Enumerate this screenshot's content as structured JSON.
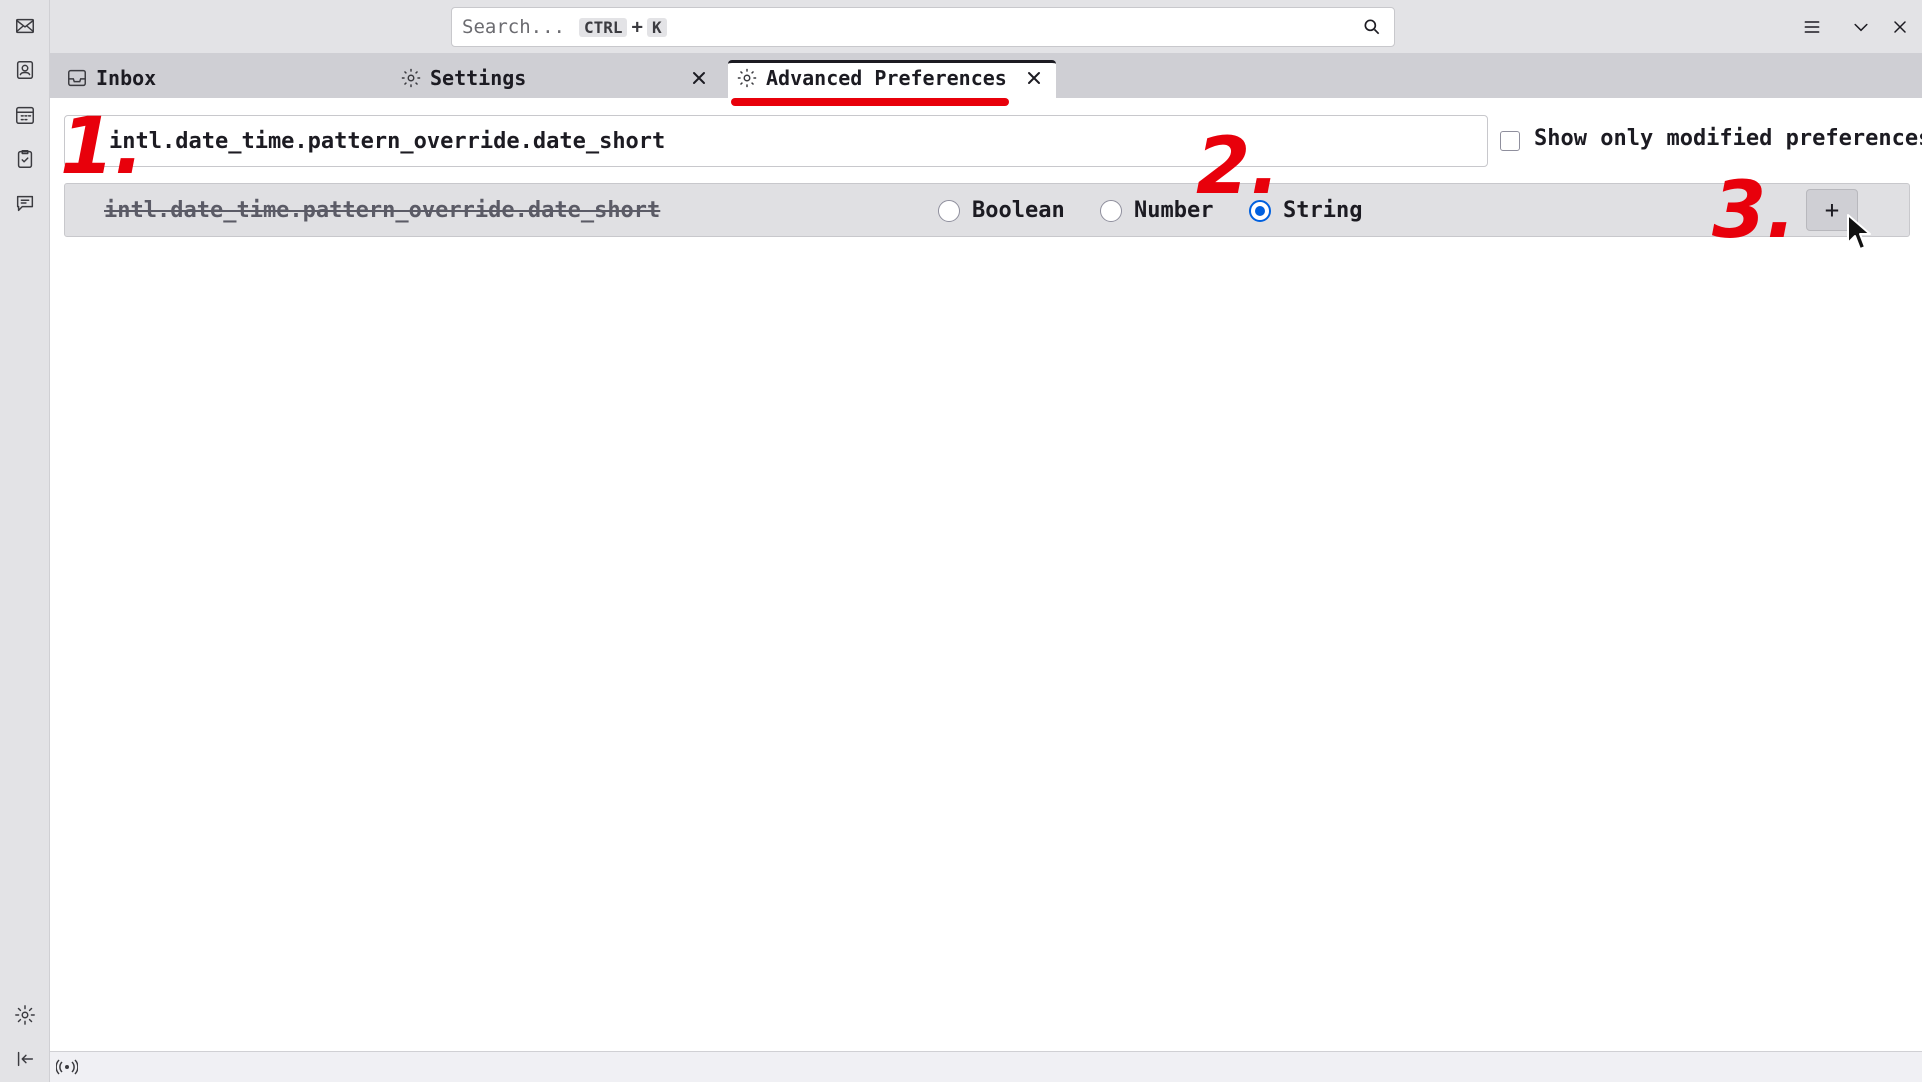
{
  "app": {
    "search": {
      "placeholder": "Search...",
      "shortcut_mod": "CTRL",
      "shortcut_plus": "+",
      "shortcut_key": "K"
    }
  },
  "spaces": [
    {
      "name": "mail",
      "icon": "envelope-icon"
    },
    {
      "name": "address-book",
      "icon": "address-book-icon"
    },
    {
      "name": "calendar",
      "icon": "calendar-icon"
    },
    {
      "name": "tasks",
      "icon": "tasks-icon"
    },
    {
      "name": "chat",
      "icon": "chat-icon"
    }
  ],
  "spaces_bottom": [
    {
      "name": "settings",
      "icon": "gear-icon"
    },
    {
      "name": "collapse",
      "icon": "collapse-left-icon"
    }
  ],
  "tabs": [
    {
      "label": "Inbox",
      "icon": "inbox-icon",
      "closable": false
    },
    {
      "label": "Settings",
      "icon": "gear-icon",
      "closable": true
    },
    {
      "label": "Advanced Preferences",
      "icon": "gear-icon",
      "closable": true,
      "selected": true
    }
  ],
  "prefs": {
    "search_value": "intl.date_time.pattern_override.date_short",
    "show_modified_label": "Show only modified preferences",
    "show_modified_checked": false,
    "new_pref": {
      "name": "intl.date_time.pattern_override.date_short",
      "types": [
        {
          "label": "Boolean",
          "checked": false
        },
        {
          "label": "Number",
          "checked": false
        },
        {
          "label": "String",
          "checked": true
        }
      ],
      "add_label": "+"
    }
  },
  "annotations": {
    "step1": "1.",
    "step2": "2.",
    "step3": "3."
  },
  "colors": {
    "annotation": "#e8000b",
    "accent": "#0060df",
    "tabstrip": "#cfcfd4"
  }
}
